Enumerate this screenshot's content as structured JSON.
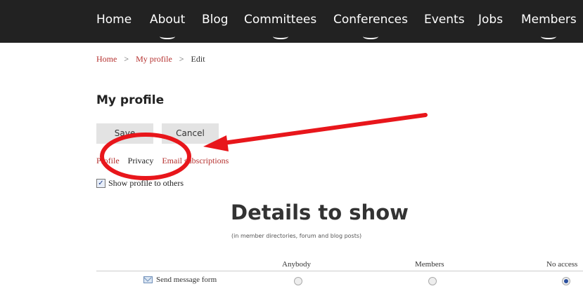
{
  "nav": {
    "items": [
      {
        "label": "Home"
      },
      {
        "label": "About"
      },
      {
        "label": "Blog"
      },
      {
        "label": "Committees"
      },
      {
        "label": "Conferences"
      },
      {
        "label": "Events"
      },
      {
        "label": "Jobs"
      },
      {
        "label": "Members"
      }
    ]
  },
  "breadcrumb": {
    "items": [
      "Home",
      "My profile",
      "Edit"
    ],
    "separator": ">"
  },
  "page": {
    "title": "My profile"
  },
  "buttons": {
    "save": "Save",
    "cancel": "Cancel"
  },
  "tabs": [
    {
      "label": "Profile",
      "active": false
    },
    {
      "label": "Privacy",
      "active": true
    },
    {
      "label": "Email subscriptions",
      "active": false
    }
  ],
  "show_profile": {
    "label": "Show profile to others",
    "checked": true
  },
  "details": {
    "heading": "Details to show",
    "subheading": "(in member directories, forum and blog posts)",
    "columns": [
      "Anybody",
      "Members",
      "No access"
    ],
    "rows": [
      {
        "label": "Send message form",
        "icon": "envelope-icon",
        "selected": "No access"
      }
    ]
  },
  "annotation": {
    "color": "#e8161b"
  },
  "colors": {
    "nav_bg": "#222222",
    "link": "#b5312f",
    "button_bg": "#e3e3e3"
  }
}
